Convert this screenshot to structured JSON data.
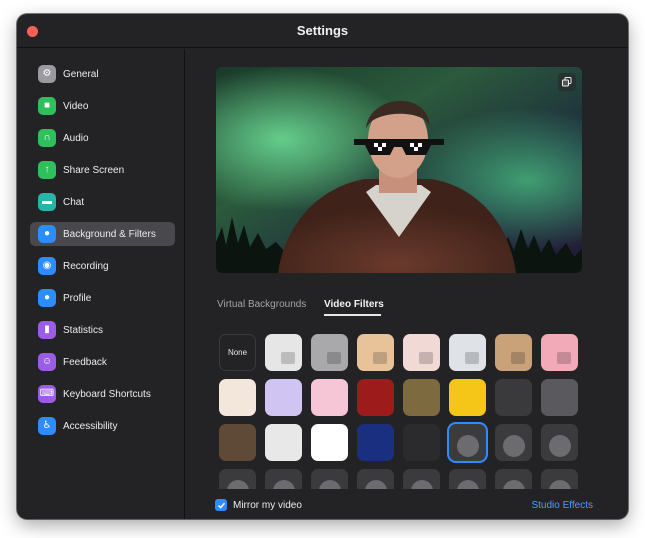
{
  "window": {
    "title": "Settings"
  },
  "sidebar": {
    "active_index": 5,
    "items": [
      {
        "label": "General",
        "icon": "gear-icon",
        "color": "#9a9a9f"
      },
      {
        "label": "Video",
        "icon": "video-camera-icon",
        "color": "#2fbf5c"
      },
      {
        "label": "Audio",
        "icon": "headphones-icon",
        "color": "#2fbf5c"
      },
      {
        "label": "Share Screen",
        "icon": "share-screen-icon",
        "color": "#2fbf5c"
      },
      {
        "label": "Chat",
        "icon": "chat-bubble-icon",
        "color": "#26b5a6"
      },
      {
        "label": "Background & Filters",
        "icon": "person-background-icon",
        "color": "#2d8cff"
      },
      {
        "label": "Recording",
        "icon": "record-icon",
        "color": "#2d8cff"
      },
      {
        "label": "Profile",
        "icon": "profile-icon",
        "color": "#2d8cff"
      },
      {
        "label": "Statistics",
        "icon": "bar-chart-icon",
        "color": "#9b5de5"
      },
      {
        "label": "Feedback",
        "icon": "smiley-icon",
        "color": "#9b5de5"
      },
      {
        "label": "Keyboard Shortcuts",
        "icon": "keyboard-icon",
        "color": "#9b5de5"
      },
      {
        "label": "Accessibility",
        "icon": "accessibility-icon",
        "color": "#2d8cff"
      }
    ]
  },
  "tabs": [
    {
      "label": "Virtual Backgrounds",
      "active": false
    },
    {
      "label": "Video Filters",
      "active": true
    }
  ],
  "filters": {
    "none_label": "None",
    "selected_index": 21,
    "tiles": [
      {
        "name": "filter-none",
        "kind": "none"
      },
      {
        "name": "filter-light-1",
        "kind": "swatch",
        "bg": "#e6e6e6"
      },
      {
        "name": "filter-grey",
        "kind": "swatch",
        "bg": "#a9a9ab"
      },
      {
        "name": "filter-warm",
        "kind": "swatch",
        "bg": "#e8c39a"
      },
      {
        "name": "filter-rose",
        "kind": "swatch",
        "bg": "#f1dad6"
      },
      {
        "name": "filter-cool",
        "kind": "swatch",
        "bg": "#dfe3e8"
      },
      {
        "name": "filter-sepia",
        "kind": "swatch",
        "bg": "#c9a27a"
      },
      {
        "name": "filter-pink",
        "kind": "swatch",
        "bg": "#f2a9b8"
      },
      {
        "name": "filter-sketch-bear",
        "kind": "frame",
        "bg": "#f3e7dc"
      },
      {
        "name": "filter-pastel-frame",
        "kind": "frame",
        "bg": "#cfc4f2"
      },
      {
        "name": "filter-love",
        "kind": "frame",
        "bg": "#f7c6d6"
      },
      {
        "name": "filter-theater",
        "kind": "frame",
        "bg": "#9e1b1b"
      },
      {
        "name": "filter-retro-tv",
        "kind": "frame",
        "bg": "#7d6a3e"
      },
      {
        "name": "filter-sunflowers",
        "kind": "frame",
        "bg": "#f5c518"
      },
      {
        "name": "filter-bulb-frame",
        "kind": "frame",
        "bg": "#3a3a3c"
      },
      {
        "name": "filter-viewfinder",
        "kind": "frame",
        "bg": "#5a5a5e"
      },
      {
        "name": "filter-old-tv",
        "kind": "frame",
        "bg": "#5e4a36"
      },
      {
        "name": "filter-ribbon",
        "kind": "frame",
        "bg": "#e8e8e8"
      },
      {
        "name": "filter-speech-bubble",
        "kind": "frame",
        "bg": "#ffffff"
      },
      {
        "name": "filter-string-lights",
        "kind": "frame",
        "bg": "#1b2f80"
      },
      {
        "name": "filter-heart-sticker",
        "kind": "frame",
        "bg": "#2b2b2d"
      },
      {
        "name": "filter-sunglasses",
        "kind": "sticker",
        "bg": "#3b3b3e"
      },
      {
        "name": "filter-sprout",
        "kind": "sticker",
        "bg": "#3b3b3e"
      },
      {
        "name": "filter-rainbow",
        "kind": "sticker",
        "bg": "#3b3b3e"
      },
      {
        "name": "filter-party-hat",
        "kind": "sticker",
        "bg": "#3b3b3e"
      },
      {
        "name": "filter-chef-hat",
        "kind": "sticker",
        "bg": "#3b3b3e"
      },
      {
        "name": "filter-halo",
        "kind": "sticker",
        "bg": "#3b3b3e"
      },
      {
        "name": "filter-headphones",
        "kind": "sticker",
        "bg": "#3b3b3e"
      },
      {
        "name": "filter-headband",
        "kind": "sticker",
        "bg": "#3b3b3e"
      },
      {
        "name": "filter-cat-ears",
        "kind": "sticker",
        "bg": "#3b3b3e"
      },
      {
        "name": "filter-bear-ears",
        "kind": "sticker",
        "bg": "#3b3b3e"
      },
      {
        "name": "filter-fox-ears",
        "kind": "sticker",
        "bg": "#3b3b3e"
      }
    ]
  },
  "footer": {
    "mirror_label": "Mirror my video",
    "mirror_checked": true,
    "studio_effects_label": "Studio Effects"
  },
  "colors": {
    "accent": "#2d8cff",
    "link": "#4b9dff",
    "window_bg": "#232325"
  }
}
